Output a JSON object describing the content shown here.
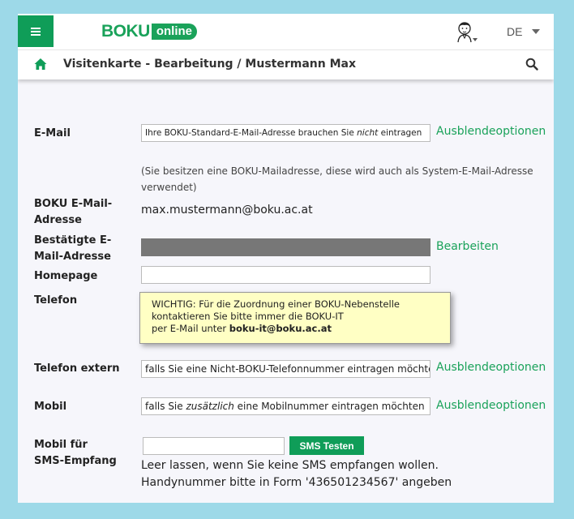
{
  "header": {
    "logo_boku": "BOKU",
    "logo_online": "online",
    "language": "DE"
  },
  "titlebar": {
    "title": "Visitenkarte - Bearbeitung / Mustermann Max"
  },
  "email": {
    "label": "E-Mail",
    "value_pre": "Ihre BOKU-Standard-E-Mail-Adresse brauchen Sie ",
    "value_em": "nicht",
    "value_post": " eintragen",
    "link": "Ausblendeoptionen",
    "note": "(Sie besitzen eine BOKU-Mailadresse, diese wird auch als System-E-Mail-Adresse verwendet)"
  },
  "boku_email": {
    "label_1": "BOKU E-Mail-",
    "label_2": "Adresse",
    "value": "max.mustermann@boku.ac.at"
  },
  "confirmed_email": {
    "label_1": "Bestätigte E-",
    "label_2": "Mail-Adresse",
    "link": "Bearbeiten"
  },
  "homepage": {
    "label": "Homepage",
    "value": ""
  },
  "telefon": {
    "label": "Telefon",
    "tooltip_line1": "WICHTIG: Für die Zuordnung einer BOKU-Nebenstelle",
    "tooltip_line2": "kontaktieren Sie bitte immer die BOKU-IT",
    "tooltip_line3_pre": "per E-Mail unter ",
    "tooltip_line3_bold": "boku-it@boku.ac.at"
  },
  "telefon_extern": {
    "label": "Telefon extern",
    "value": "falls Sie eine Nicht-BOKU-Telefonnummer eintragen möchten",
    "link": "Ausblendeoptionen"
  },
  "mobil": {
    "label": "Mobil",
    "value_pre": "falls Sie ",
    "value_em": "zusätzlich",
    "value_post": " eine Mobilnummer eintragen möchten",
    "link": "Ausblendeoptionen"
  },
  "mobil_sms": {
    "label_1": "Mobil für",
    "label_2": "SMS-Empfang",
    "value": "",
    "button": "SMS Testen",
    "hint_1": "Leer lassen, wenn Sie keine SMS empfangen wollen.",
    "hint_2": "Handynummer bitte in Form '436501234567' angeben"
  },
  "colors": {
    "accent": "#0f9d58",
    "link": "#1aa25a",
    "tooltip_bg": "#ffffc4",
    "page_bg": "#9dd9e8"
  },
  "icons": [
    "menu-icon",
    "avatar-icon",
    "chevron-down-icon",
    "home-icon",
    "search-icon"
  ]
}
